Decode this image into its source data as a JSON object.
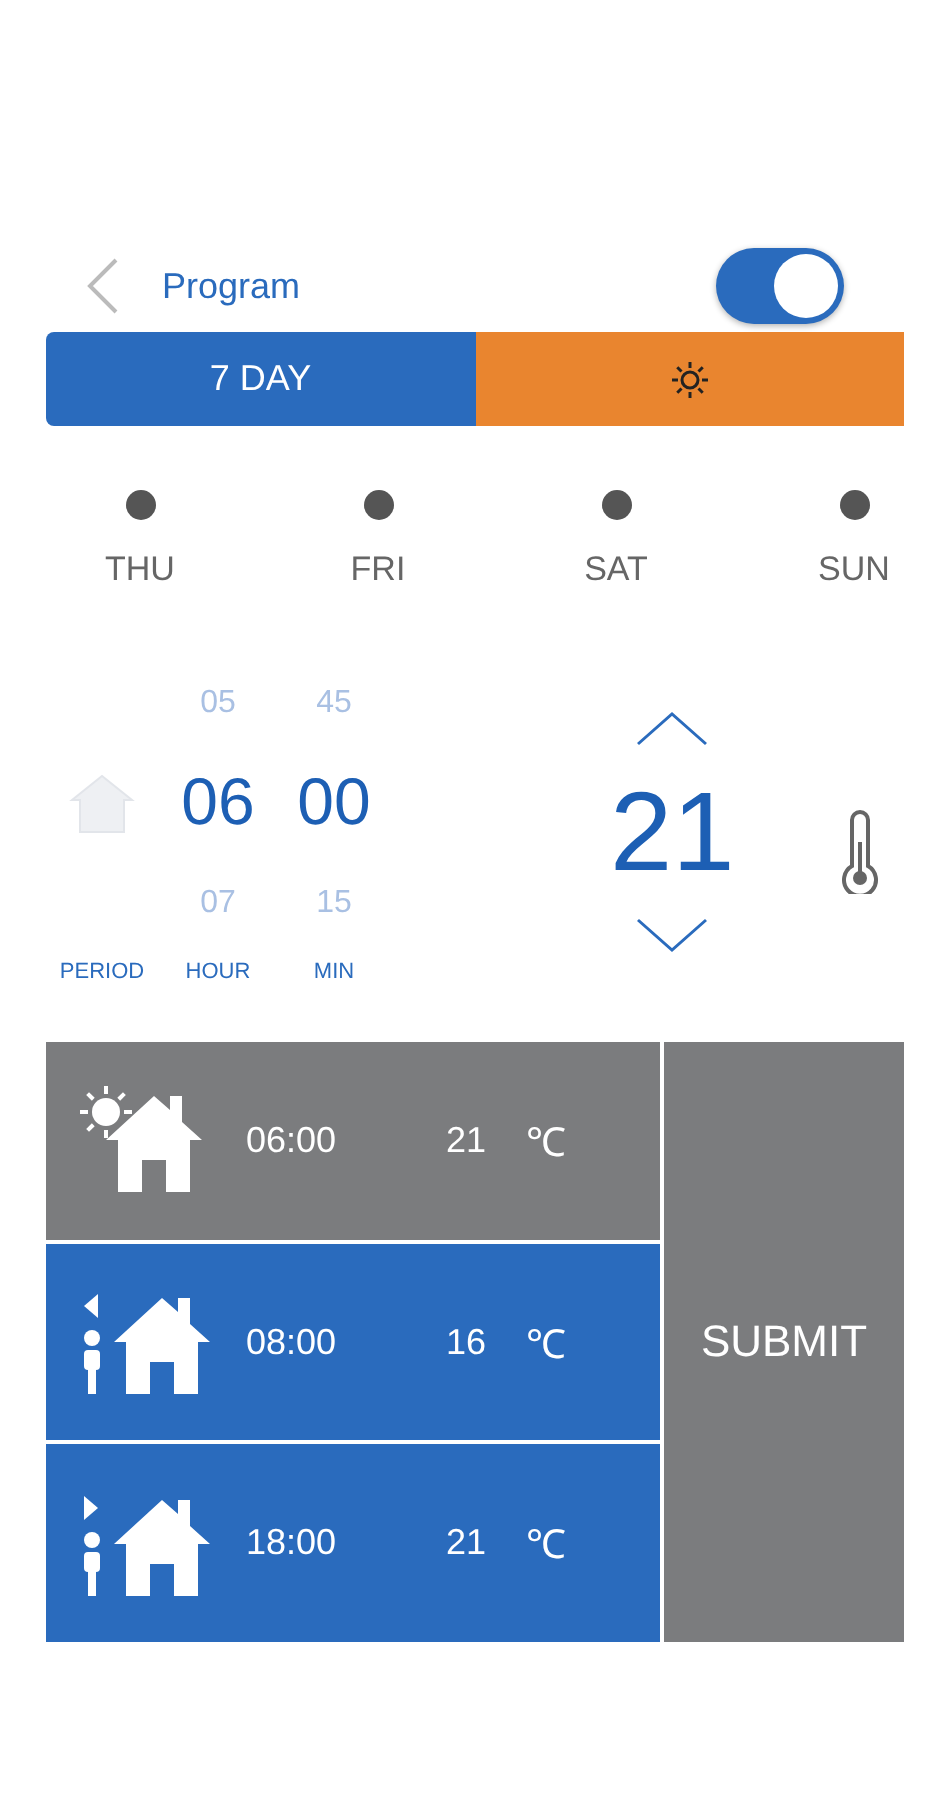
{
  "header": {
    "title": "Program",
    "toggle_on": true
  },
  "mode_tabs": [
    {
      "kind": "text",
      "label": "7 DAY",
      "selected": true
    },
    {
      "kind": "sun",
      "selected": false
    }
  ],
  "days": [
    {
      "label": "THU"
    },
    {
      "label": "FRI"
    },
    {
      "label": "SAT"
    },
    {
      "label": "SUN"
    }
  ],
  "picker": {
    "hour_prev": "05",
    "hour": "06",
    "hour_next": "07",
    "min_prev": "45",
    "min": "00",
    "min_next": "15",
    "labels": [
      "PERIOD",
      "HOUR",
      "MIN"
    ],
    "temperature": "21"
  },
  "periods": [
    {
      "kind": "sun",
      "time": "06:00",
      "temperature": "21",
      "unit": "℃",
      "selected": true
    },
    {
      "kind": "leave",
      "time": "08:00",
      "temperature": "16",
      "unit": "℃",
      "selected": false
    },
    {
      "kind": "return",
      "time": "18:00",
      "temperature": "21",
      "unit": "℃",
      "selected": false
    }
  ],
  "submit": "SUBMIT"
}
